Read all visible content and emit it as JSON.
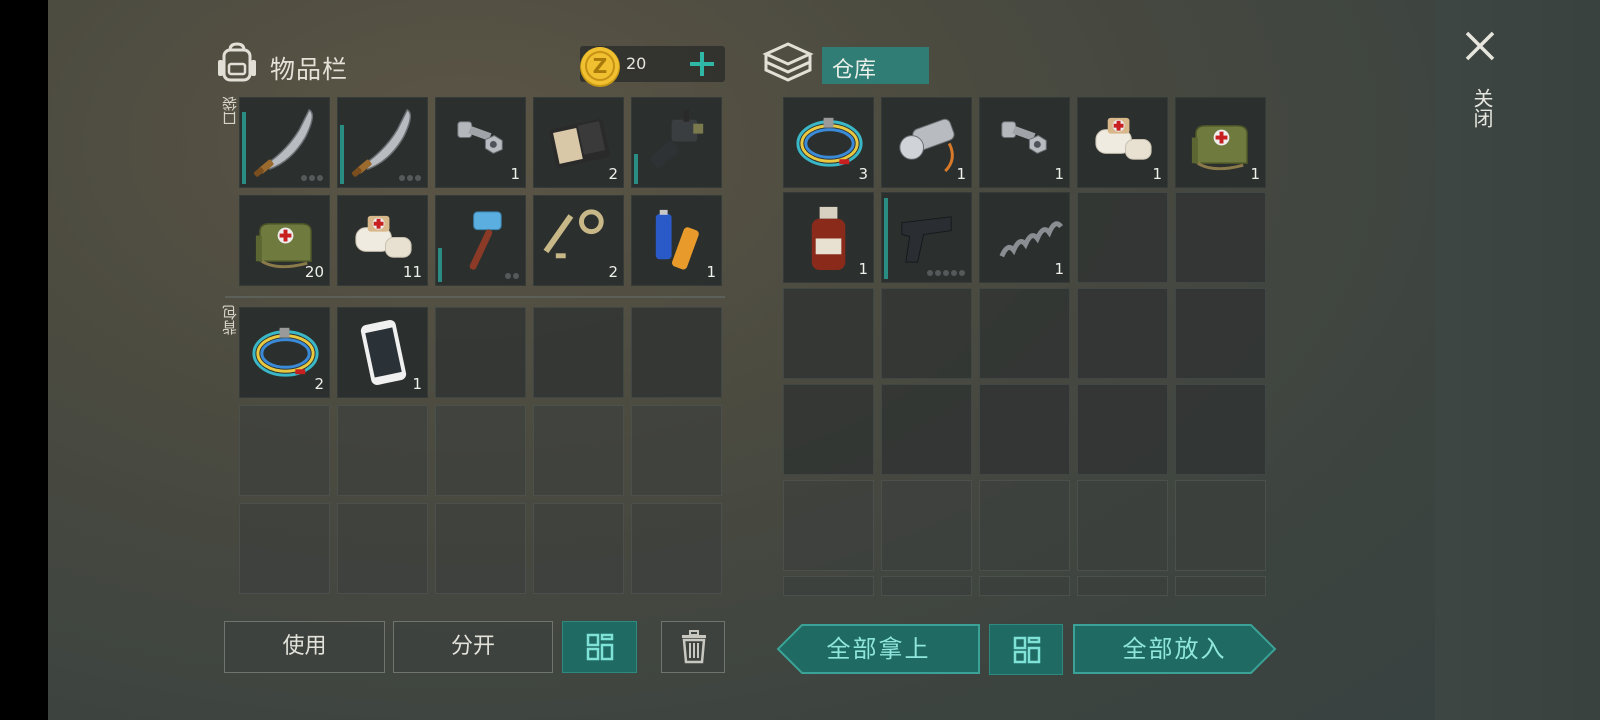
{
  "inventory": {
    "title": "物品栏",
    "coins": "20",
    "pocket_label": "口袋",
    "backpack_label": "背包",
    "pocket_slots": [
      {
        "icon": "machete-icon",
        "count": "",
        "durability": 0.85,
        "dots": 3
      },
      {
        "icon": "machete-icon",
        "count": "",
        "durability": 0.7,
        "dots": 3
      },
      {
        "icon": "bolt-nut-icon",
        "count": "1"
      },
      {
        "icon": "wallet-icon",
        "count": "2"
      },
      {
        "icon": "binoculars-scope-icon",
        "count": "",
        "durability": 0.35
      },
      {
        "icon": "medkit-bag-icon",
        "count": "20"
      },
      {
        "icon": "bandage-icon",
        "count": "11"
      },
      {
        "icon": "hammer-icon",
        "count": "",
        "durability": 0.4,
        "dots": 2
      },
      {
        "icon": "key-icon",
        "count": "2"
      },
      {
        "icon": "batteries-icon",
        "count": "1"
      }
    ],
    "backpack_slots": [
      {
        "icon": "wire-coil-icon",
        "count": "2"
      },
      {
        "icon": "smartphone-icon",
        "count": "1"
      }
    ],
    "buttons": {
      "use": "使用",
      "split": "分开"
    }
  },
  "storage": {
    "title": "仓库",
    "slots": [
      {
        "icon": "wire-coil-icon",
        "count": "3"
      },
      {
        "icon": "flashlight-icon",
        "count": "1"
      },
      {
        "icon": "bolt-nut-icon",
        "count": "1"
      },
      {
        "icon": "bandage-icon",
        "count": "1"
      },
      {
        "icon": "medkit-bag-icon",
        "count": "1"
      },
      {
        "icon": "medicine-bottle-icon",
        "count": "1"
      },
      {
        "icon": "pistol-icon",
        "count": "",
        "durability": 0.95,
        "dots": 5
      },
      {
        "icon": "spring-icon",
        "count": "1"
      }
    ],
    "buttons": {
      "take_all": "全部拿上",
      "put_all": "全部放入"
    }
  },
  "close_label": "关闭",
  "colors": {
    "accent": "#2f7d74",
    "durability": "#2a8d84"
  }
}
